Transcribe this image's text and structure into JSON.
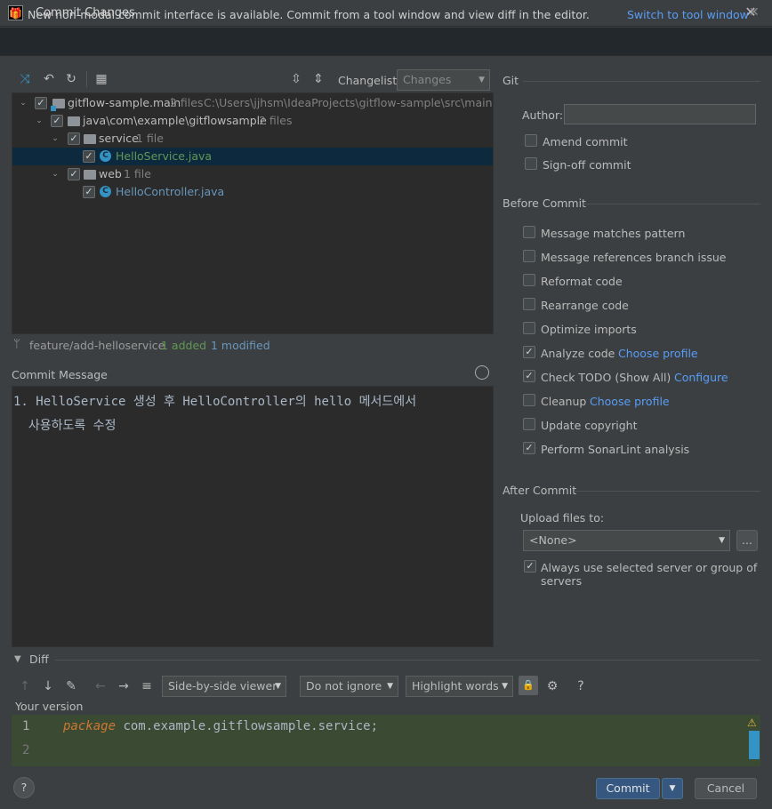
{
  "window": {
    "title": "Commit Changes",
    "app_icon_text": "IJ"
  },
  "banner": {
    "text": "New non-modal commit interface is available. Commit from a tool window and view diff in the editor.",
    "link": "Switch to tool window"
  },
  "toolbar": {
    "changelist_label": "Changelist:",
    "changelist_value": "Changes"
  },
  "tree": {
    "rows": [
      {
        "name": "gitflow-sample.main",
        "count": "2 files",
        "path": "C:\\Users\\jjhsm\\IdeaProjects\\gitflow-sample\\src\\main"
      },
      {
        "name": "java\\com\\example\\gitflowsample",
        "count": "2 files"
      },
      {
        "name": "service",
        "count": "1 file"
      },
      {
        "name": "HelloService.java"
      },
      {
        "name": "web",
        "count": "1 file"
      },
      {
        "name": "HelloController.java"
      }
    ]
  },
  "status": {
    "branch": "feature/add-helloservice",
    "added": "1 added",
    "modified": "1 modified"
  },
  "commit_message": {
    "label": "Commit Message",
    "line1": "1. HelloService 생성 후 HelloController의 hello 메서드에서",
    "line2": "  사용하도록 수정"
  },
  "git": {
    "title": "Git",
    "author_label": "Author:",
    "author_value": "",
    "amend": "Amend commit",
    "signoff": "Sign-off commit"
  },
  "before_commit": {
    "title": "Before Commit",
    "items": [
      {
        "label": "Message matches pattern",
        "checked": false
      },
      {
        "label": "Message references branch issue",
        "checked": false
      },
      {
        "label": "Reformat code",
        "checked": false
      },
      {
        "label": "Rearrange code",
        "checked": false
      },
      {
        "label": "Optimize imports",
        "checked": false
      },
      {
        "label": "Analyze code",
        "link": "Choose profile",
        "checked": true
      },
      {
        "label": "Check TODO (Show All)",
        "link": "Configure",
        "checked": true
      },
      {
        "label": "Cleanup",
        "link": "Choose profile",
        "checked": false
      },
      {
        "label": "Update copyright",
        "checked": false
      },
      {
        "label": "Perform SonarLint analysis",
        "checked": true
      }
    ]
  },
  "after_commit": {
    "title": "After Commit",
    "upload_label": "Upload files to:",
    "upload_value": "<None>",
    "more": "...",
    "always_use": "Always use selected server or group of servers"
  },
  "diff": {
    "title": "Diff",
    "viewer": "Side-by-side viewer",
    "ignore": "Do not ignore",
    "highlight": "Highlight words",
    "help": "?",
    "your_version": "Your version",
    "lines": [
      {
        "num": "1",
        "keyword": "package",
        "text": " com.example.gitflowsample.service;"
      },
      {
        "num": "2",
        "keyword": "",
        "text": ""
      }
    ]
  },
  "footer": {
    "help": "?",
    "commit": "Commit",
    "cancel": "Cancel"
  },
  "colors": {
    "accent": "#3592c4",
    "link": "#589df6",
    "added": "#629755",
    "modified": "#6897bb",
    "diff_bg": "#3b4a32"
  }
}
